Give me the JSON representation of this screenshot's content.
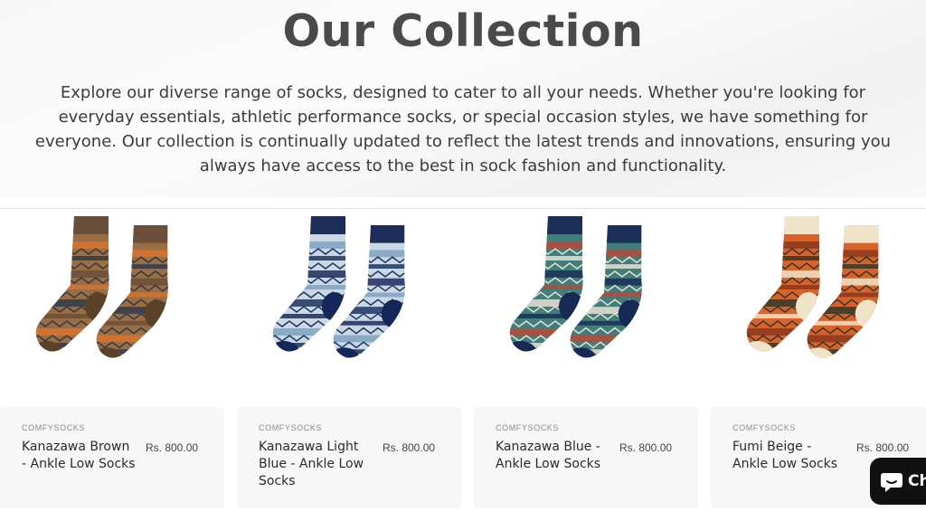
{
  "section": {
    "title": "Our Collection",
    "description": "Explore our diverse range of socks, designed to cater to all your needs. Whether you're looking for everyday essentials, athletic performance socks, or special occasion styles, we have something for everyone. Our collection is continually updated to reflect the latest trends and innovations, ensuring you always have access to the best in sock fashion and functionality."
  },
  "products": [
    {
      "brand": "COMFYSOCKS",
      "title": "Kanazawa Brown - Ankle Low Socks",
      "price": "Rs. 800.00",
      "colors": {
        "cuff": "#6b4f3a",
        "body": "#9a6d42",
        "accent": "#d9732f",
        "pattern": "#2f3b4a",
        "heel": "#5a4128"
      }
    },
    {
      "brand": "COMFYSOCKS",
      "title": "Kanazawa Light Blue - Ankle Low Socks",
      "price": "Rs. 800.00",
      "colors": {
        "cuff": "#1c2d5a",
        "body": "#c9d8e4",
        "accent": "#7fa3c0",
        "pattern": "#1f3560",
        "heel": "#15275a"
      }
    },
    {
      "brand": "COMFYSOCKS",
      "title": "Kanazawa Blue - Ankle Low Socks",
      "price": "Rs. 800.00",
      "colors": {
        "cuff": "#1b2f57",
        "body": "#3f7e7a",
        "accent": "#b84a3a",
        "pattern": "#e8e0d2",
        "heel": "#172a55"
      }
    },
    {
      "brand": "COMFYSOCKS",
      "title": "Fumi Beige - Ankle Low Socks",
      "price": "Rs. 800.00",
      "colors": {
        "cuff": "#efe4c8",
        "body": "#d9622b",
        "accent": "#8a3a1e",
        "pattern": "#2f3a2a",
        "heel": "#efe4c8"
      }
    }
  ],
  "chat": {
    "label": "Ch",
    "icon": "chat-bubble-icon"
  }
}
